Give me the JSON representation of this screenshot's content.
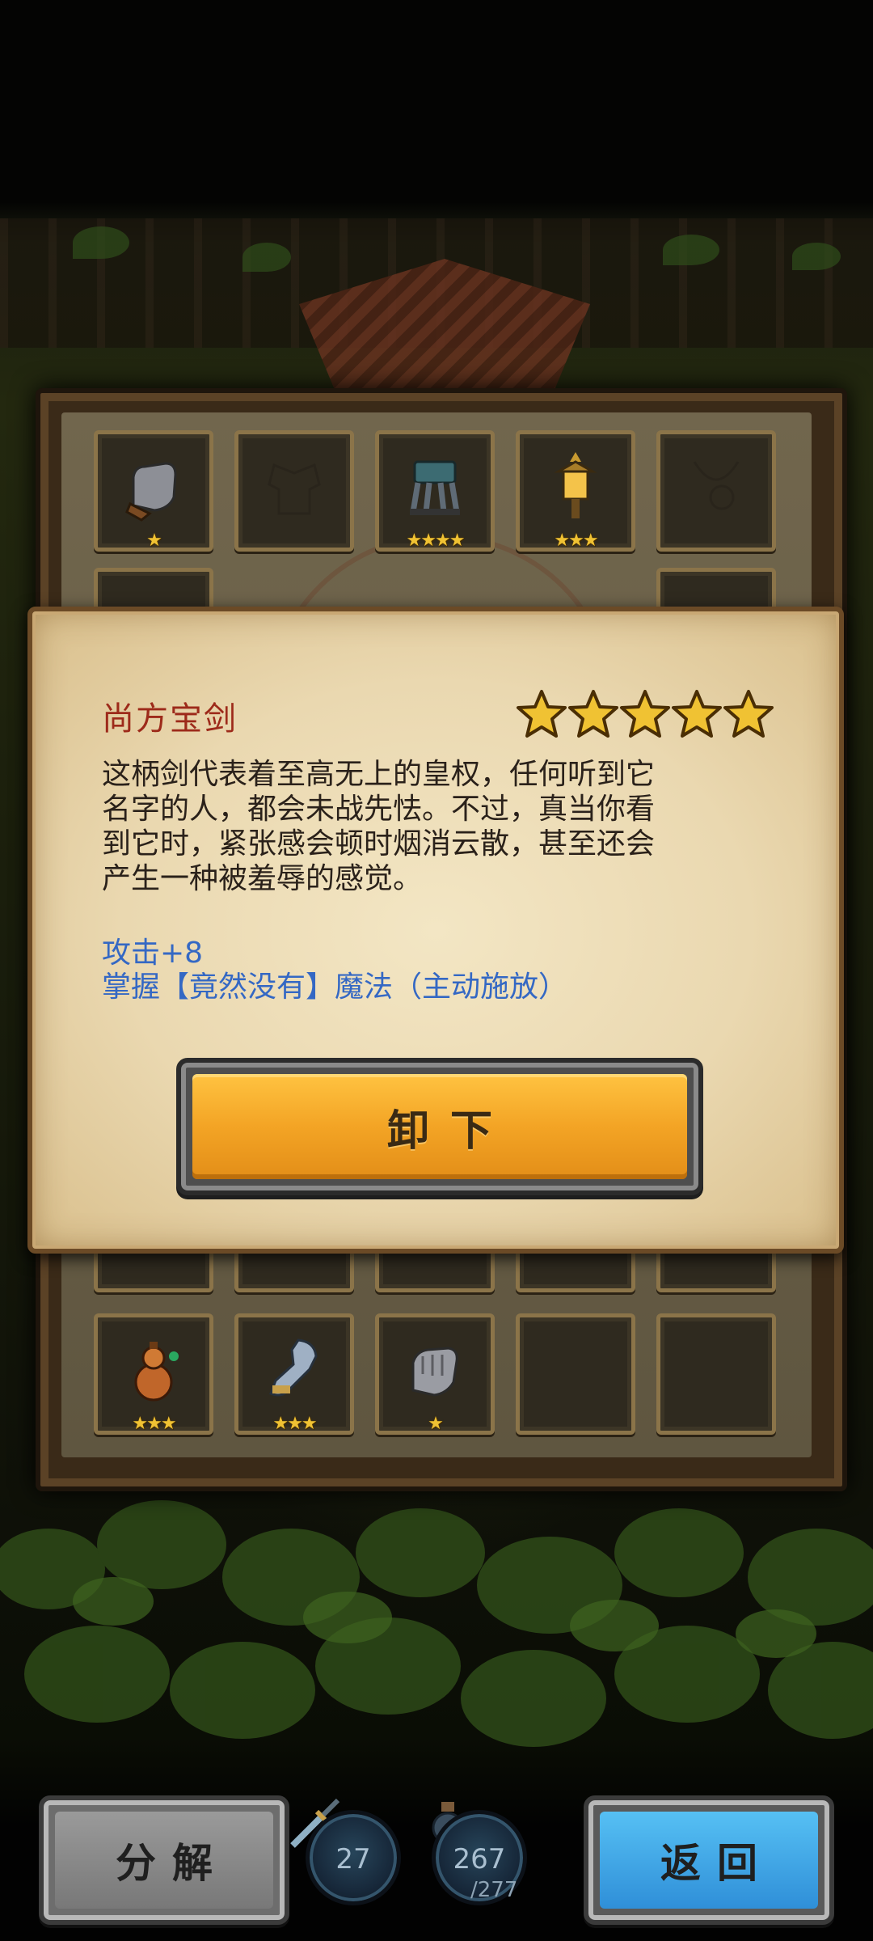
{
  "inventory": {
    "rows": [
      [
        {
          "item": "gauntlet-icon",
          "stars": "★"
        },
        {
          "item": "armor-silhouette-icon",
          "stars": ""
        },
        {
          "item": "mechanical-legs-icon",
          "stars": "★★★★"
        },
        {
          "item": "lantern-icon",
          "stars": "★★★"
        },
        {
          "item": "amulet-silhouette-icon",
          "stars": ""
        }
      ],
      [
        {
          "item": "gourd-icon",
          "stars": "★★★"
        },
        {
          "item": "armored-arm-icon",
          "stars": "★★★"
        },
        {
          "item": "gauntlet-icon",
          "stars": "★"
        },
        {
          "item": "",
          "stars": ""
        },
        {
          "item": "",
          "stars": ""
        }
      ]
    ]
  },
  "detail": {
    "name": "尚方宝剑",
    "rating": 5,
    "description_lines": [
      "这柄剑代表着至高无上的皇权，任何听到它",
      "名字的人，都会未战先怯。不过，真当你看",
      "到它时，紧张感会顿时烟消云散，甚至还会",
      "产生一种被羞辱的感觉。"
    ],
    "stats": [
      "攻击+8",
      "掌握【竟然没有】魔法（主动施放）"
    ],
    "unequip_label": "卸下"
  },
  "bottom_bar": {
    "decompose_label": "分解",
    "back_label": "返回",
    "counter_a": "27",
    "counter_b": "267",
    "counter_b_max": "/277"
  },
  "colors": {
    "title": "#9d2a1a",
    "stat_text": "#3468c4",
    "star": "#f0c233",
    "unequip_button": "#f3a425",
    "back_button": "#3aa3e6"
  }
}
